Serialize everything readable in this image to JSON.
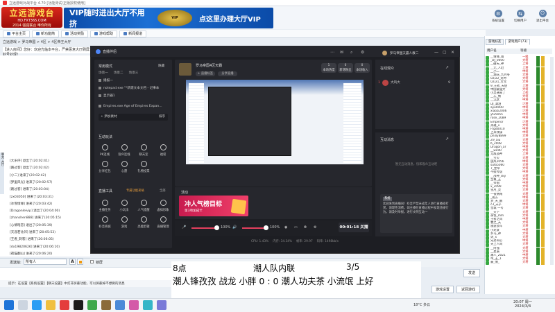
{
  "window": {
    "title": "立远游戏对战平台 4.70 [功能测试/正版授权使用]"
  },
  "banner": {
    "logo_line1": "立远游戏台",
    "logo_line2": "HD.FXT365.COM",
    "logo_line3": "2014 强强联合 唯你所有",
    "vip_left": "VIP随时进出大厅不用挤",
    "emblem": "VIP",
    "vip_right": "点这里办理大厅VIP"
  },
  "top_icons": [
    {
      "label": "系统设置",
      "icon": "gear-icon"
    },
    {
      "label": "切换用户",
      "icon": "user-switch-icon"
    },
    {
      "label": "退出平台",
      "icon": "exit-icon"
    }
  ],
  "tabs": [
    {
      "label": "平台主页"
    },
    {
      "label": "新功能简"
    },
    {
      "label": "活动奖励"
    },
    {
      "label": "游戏帮助"
    },
    {
      "label": "新闻报道"
    }
  ],
  "breadcrumb": "立远游戏 > 罗马帝国 > 4区 > 4区帝王大厅",
  "room_notice": "【进入房间】您好：欢迎光临本平台，严禁恶意大厅刷屏，发现封号处理！",
  "chat_lines": [
    "[大乐仔] 退出了(20:02:41)",
    "[路过客] 退出了(20:02:42)",
    "[小二] 进来了(20:02:42)",
    "[梦里风光] 进来了(20:02:57)",
    "[路过客] 进来了(20:03:04)",
    "[zx03050] 进来了(20:03:31)",
    "[冰雪情缘] 进来了(20:03:42)",
    "[Dragonleivip] 退出了(20:04:00)",
    "[zhanshen888] 进来了(20:05:15)",
    "[心情暗恋] 退出了(20:05:39)",
    "[天涯若比邻] 进来了(20:05:53)",
    "[王者_刺客] 进来了(20:06:05)",
    "[dx19820626] 进来了(20:06:10)",
    "[夜猫翻山] 进来了(20:06:20)"
  ],
  "chat_target": {
    "label": "发送给:",
    "value": "所有人"
  },
  "format_btn": "A",
  "lock_label": "锁屏",
  "send_label": "发送",
  "tip_text": "提示：在设置【系统设置】【聊天设置】中打开屏蔽功能，可以屏蔽掉不想要的消息",
  "bottom_buttons": [
    "游戏设置",
    "返回游戏"
  ],
  "user_panel": {
    "tabs": [
      "游戏好友",
      "游戏用户(73)"
    ],
    "headers": [
      "用户名",
      "等级",
      ""
    ],
    "users": [
      [
        "__情缘_雨",
        "一级"
      ],
      [
        "_DJ_0000",
        "大将"
      ],
      [
        "__破天_神",
        "上将"
      ],
      [
        "__无_人赶",
        "上将"
      ],
      [
        "__小二",
        "中将"
      ],
      [
        "__烟花_九月冬",
        "大将"
      ],
      [
        "02/22_龙吟",
        "大将"
      ],
      [
        "02/21_宝宝",
        "大将"
      ],
      [
        "9_王者_天使",
        "上将"
      ],
      [
        "中国最强大",
        "大将"
      ],
      [
        "小灵通来了",
        "上校"
      ],
      [
        "__忘_情",
        "大将"
      ],
      [
        "__沉默",
        "中将"
      ],
      [
        "DJ_潇洒",
        "少将"
      ],
      [
        "ayo0000",
        "中将"
      ],
      [
        "xiaozi2006",
        "少将"
      ],
      [
        "yt25055",
        "中将"
      ],
      [
        "rose_2089",
        "中将"
      ],
      [
        "Emperor",
        "少将"
      ],
      [
        "英雄_x",
        "大将"
      ],
      [
        "Ftgd0010",
        "中将"
      ],
      [
        "上兵伐谋",
        "中将"
      ],
      [
        "philly8899",
        "大将"
      ],
      [
        "Z9_aiu",
        "大将"
      ],
      [
        "b_2008",
        "大将"
      ],
      [
        "Dragon_ar",
        "中将"
      ],
      [
        "__wo90",
        "大将"
      ],
      [
        "无敌战神",
        "上将"
      ],
      [
        "__宝贝",
        "大将"
      ],
      [
        "旋风2056",
        "中将"
      ],
      [
        "sufo5060",
        "大将"
      ],
      [
        "7_皇帝",
        "大将"
      ],
      [
        "不败传说",
        "中将"
      ],
      [
        "__战神_sky",
        "大将"
      ],
      [
        "至尊_王",
        "大将"
      ],
      [
        "__帝国",
        "中将"
      ],
      [
        "x_2099",
        "大将"
      ],
      [
        "雪月_灵",
        "大将"
      ],
      [
        "一夜情殇",
        "大将"
      ],
      [
        "_南方",
        "中将"
      ],
      [
        "梦_天_鹏",
        "大将"
      ],
      [
        "c3_天子",
        "中将"
      ],
      [
        "皇城 一号",
        "大将"
      ],
      [
        "__天下",
        "大将"
      ],
      [
        "永恒_mm",
        "大将"
      ],
      [
        "王者之风",
        "中将"
      ],
      [
        "曹之_天",
        "大将"
      ],
      [
        "雷霆战车",
        "大将"
      ],
      [
        "小龙女",
        "中将"
      ],
      [
        "罗马_神",
        "大将"
      ],
      [
        "剑_x",
        "大将"
      ],
      [
        "兄弟同心",
        "中将"
      ],
      [
        "天上人间",
        "大将"
      ],
      [
        "__阿强",
        "大将"
      ],
      [
        "__星辰",
        "大将"
      ],
      [
        "潮人_2021",
        "中将"
      ],
      [
        "帝_王_1",
        "大将"
      ],
      [
        "豪_情_",
        "大将"
      ]
    ]
  },
  "stream": {
    "app_title": "直播伴侣",
    "user_label": "罗马帝国天霸人教二",
    "scene_title": "常用模式",
    "scene_tabs": [
      "场景一",
      "场景二",
      "场景三"
    ],
    "scene_right": "隐藏",
    "sources_header": "播报一",
    "sources": [
      "notepad.exe \"*新建文本文档 - 记事本",
      "显示器1",
      "Empires.exe Age of Empires Expan..."
    ],
    "add_source": "+ 添加素材",
    "add_source_right": "排序",
    "interact_title": "互动玩法",
    "interact_items": [
      "PK连线",
      "观众连线",
      "聊天室",
      "福袋",
      "分享红包",
      "心愿",
      "礼物投票"
    ],
    "tools_title": "直播工具",
    "tools_right": "全部",
    "tools_hint": "专属功能来咯",
    "tools_items": [
      "主播任务",
      "小玩法",
      "人气提醒",
      "虚拟形象",
      "抖音商城",
      "游戏",
      "高能剪辑",
      "直播管理"
    ],
    "streamer_name": "罗马帝国4区天霸",
    "tag1": "+ 直播标签",
    "tag2": "分享直播",
    "stats": [
      {
        "value": "1",
        "label": "本场热度"
      },
      {
        "value": "0",
        "label": "新增粉丝"
      },
      {
        "value": "0",
        "label": "本场收入"
      }
    ],
    "activity_label": "活动",
    "activity_title": "冲人气榜目标",
    "activity_sub": "第3项加成卡",
    "volume1": "100%",
    "volume2": "100%",
    "duration": "00:01:18",
    "end_label": "关播",
    "status_items": [
      "CPU: 1.43%",
      "内存: 34.34%",
      "帧率: 29.97",
      "码率: 1498kb/s"
    ],
    "high_value_title": "在线观众",
    "high_value_user": "大风大",
    "high_value_count": "9",
    "chat_title": "互动消息",
    "chat_empty": "暂无互动消息，快和观众互动吧",
    "notice_tag": "系统",
    "notice_text": "欢迎来到直播间！抖音严禁未成年人进行直播或打赏，请理性消费。如主播在直播过程中发现违规行为，请及时举报，进行文明互动～"
  },
  "overlay": {
    "time": "8点",
    "title": "潮人队内联",
    "score": "3/5",
    "players": "潮人锋孜孜  战龙  小胖 0 :  0  潮人功夫茶  小流氓  上好"
  },
  "taskbar": {
    "temp": "18°C 多云",
    "time": "20:07 周一",
    "date": "2024/3/4"
  }
}
